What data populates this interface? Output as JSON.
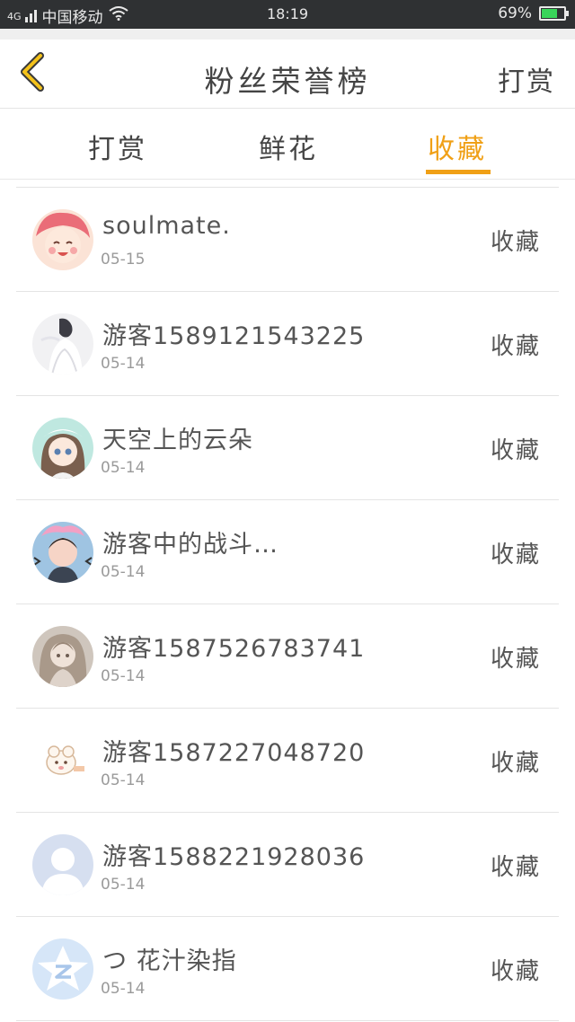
{
  "status_bar": {
    "signal_text": "4G",
    "carrier": "中国移动",
    "time": "18:19",
    "battery_percent": "69%",
    "battery_level": 0.69
  },
  "header": {
    "back_icon": "chevron-left-icon",
    "title": "粉丝荣誉榜",
    "action_label": "打赏"
  },
  "tabs": {
    "items": [
      {
        "label": "打赏"
      },
      {
        "label": "鲜花"
      },
      {
        "label": "收藏"
      }
    ],
    "active_index": 2,
    "accent_color": "#f0a016"
  },
  "list": {
    "items": [
      {
        "name": "soulmate.",
        "date": "05-15",
        "action": "收藏"
      },
      {
        "name": "游客1589121543225",
        "date": "05-14",
        "action": "收藏"
      },
      {
        "name": "天空上的云朵",
        "date": "05-14",
        "action": "收藏"
      },
      {
        "name": "游客中的战斗…",
        "date": "05-14",
        "action": "收藏"
      },
      {
        "name": "游客1587526783741",
        "date": "05-14",
        "action": "收藏"
      },
      {
        "name": "游客1587227048720",
        "date": "05-14",
        "action": "收藏"
      },
      {
        "name": "游客1588221928036",
        "date": "05-14",
        "action": "收藏"
      },
      {
        "name": "つ 花汁染指",
        "date": "05-14",
        "action": "收藏"
      }
    ]
  }
}
